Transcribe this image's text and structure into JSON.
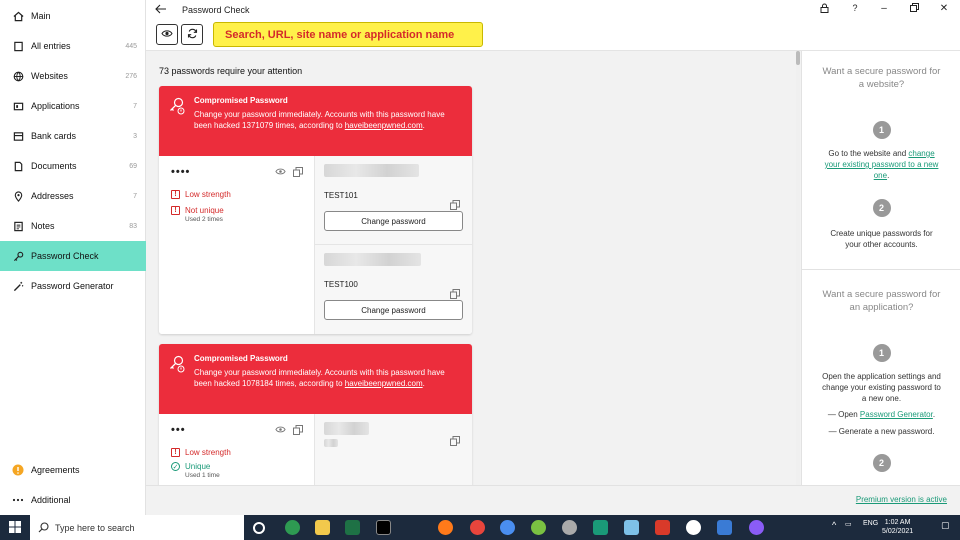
{
  "window": {
    "title": "Password Check"
  },
  "sidebar": {
    "items": [
      {
        "label": "Main",
        "count": "",
        "icon": "home-icon"
      },
      {
        "label": "All entries",
        "count": "445",
        "icon": "entries-icon"
      },
      {
        "label": "Websites",
        "count": "276",
        "icon": "globe-icon"
      },
      {
        "label": "Applications",
        "count": "7",
        "icon": "apps-icon"
      },
      {
        "label": "Bank cards",
        "count": "3",
        "icon": "card-icon"
      },
      {
        "label": "Documents",
        "count": "69",
        "icon": "document-icon"
      },
      {
        "label": "Addresses",
        "count": "7",
        "icon": "pin-icon"
      },
      {
        "label": "Notes",
        "count": "83",
        "icon": "notes-icon"
      },
      {
        "label": "Password Check",
        "count": "",
        "icon": "key-icon"
      },
      {
        "label": "Password Generator",
        "count": "",
        "icon": "wand-icon"
      }
    ],
    "bottom": [
      {
        "label": "Agreements",
        "icon": "warning-icon"
      },
      {
        "label": "Additional",
        "icon": "more-icon"
      }
    ]
  },
  "toolbar": {
    "search_placeholder": "Search, URL, site name or application name"
  },
  "main": {
    "attention": "73 passwords require your attention",
    "cards": [
      {
        "heading": "Compromised Password",
        "text": "Change your password immediately. Accounts with this password have been hacked 1371079 times, according to",
        "link": "haveibeenpwned.com",
        "mask": "••••",
        "strength": "Low strength",
        "uniqueness": "Not unique",
        "used": "Used 2 times",
        "accounts": [
          {
            "name": "TEST101",
            "button": "Change password"
          },
          {
            "name": "TEST100",
            "button": "Change password"
          }
        ]
      },
      {
        "heading": "Compromised Password",
        "text": "Change your password immediately. Accounts with this password have been hacked 1078184 times, according to",
        "link": "haveibeenpwned.com",
        "mask": "•••",
        "strength": "Low strength",
        "uniqueness": "Unique",
        "used": "Used 1 time"
      }
    ]
  },
  "right_panel": {
    "website": {
      "heading": "Want a secure password for a website?",
      "step1_pre": "Go to the website and ",
      "step1_link": "change your existing password to a new one",
      "step1_post": ".",
      "step2": "Create unique passwords for your other accounts."
    },
    "application": {
      "heading": "Want a secure password for an application?",
      "step1": "Open the application settings and change your existing password to a new one.",
      "open_pre": "— Open ",
      "open_link": "Password Generator",
      "open_post": ".",
      "generate": "— Generate a new password."
    },
    "numbers": [
      "1",
      "2",
      "1",
      "2"
    ]
  },
  "status": {
    "premium": "Premium version is active"
  },
  "taskbar": {
    "search": "Type here to search",
    "lang": "ENG",
    "time": "1:02 AM",
    "date": "5/02/2021"
  }
}
